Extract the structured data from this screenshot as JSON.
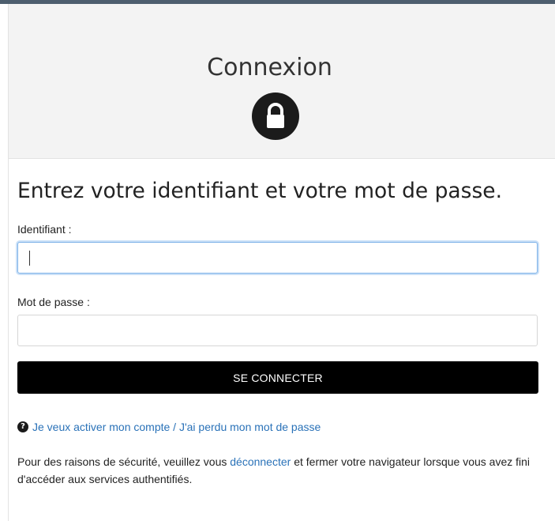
{
  "header": {
    "title": "Connexion",
    "icon": "lock-icon"
  },
  "form": {
    "heading": "Entrez votre identifiant et votre mot de passe.",
    "username_label": "Identifiant :",
    "username_value": "",
    "password_label": "Mot de passe :",
    "password_value": "",
    "submit_label": "SE CONNECTER"
  },
  "help": {
    "icon": "question-circle-icon",
    "link_text": "Je veux activer mon compte / J'ai perdu mon mot de passe"
  },
  "security_note": {
    "before": "Pour des raisons de sécurité, veuillez vous ",
    "link_text": "déconnecter",
    "after": " et fermer votre navigateur lorsque vous avez fini d'accéder aux services authentifiés."
  },
  "colors": {
    "accent_bar": "#4d5e6e",
    "header_bg": "#f3f3f3",
    "button_bg": "#000000",
    "link": "#2a72b8",
    "focus_border": "#7fb3e8"
  }
}
